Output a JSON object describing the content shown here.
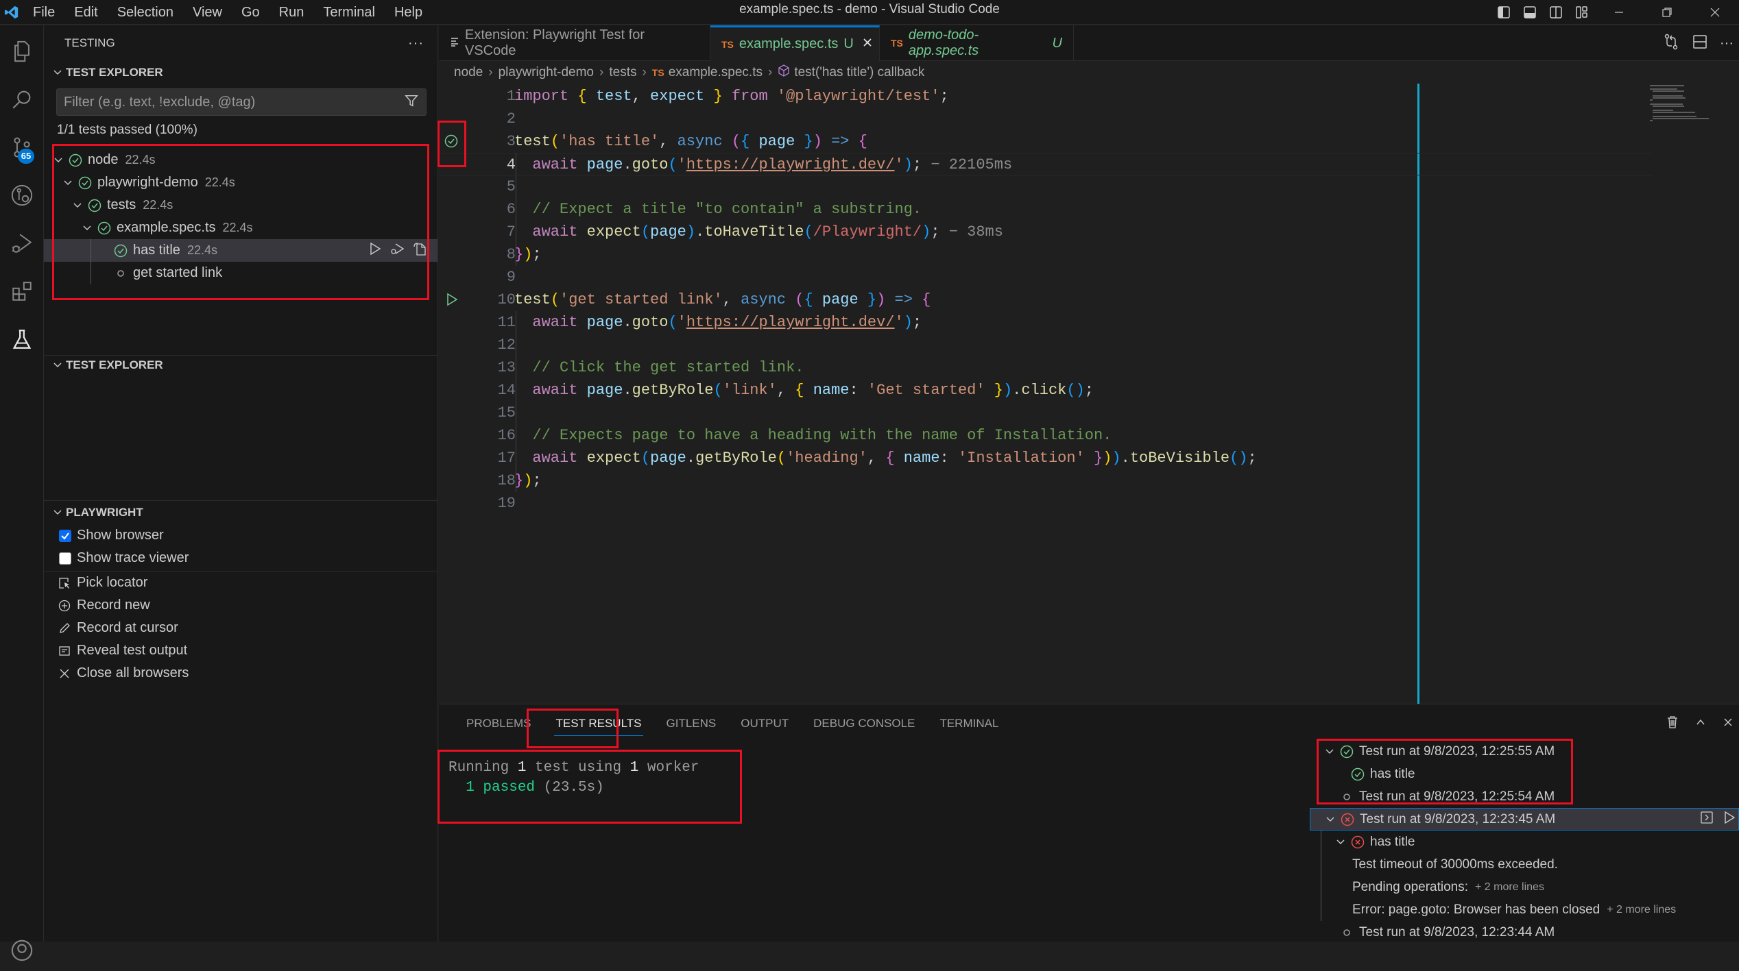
{
  "titlebar": {
    "title": "example.spec.ts - demo - Visual Studio Code",
    "menu": [
      "File",
      "Edit",
      "Selection",
      "View",
      "Go",
      "Run",
      "Terminal",
      "Help"
    ]
  },
  "activity_bar": {
    "items": [
      "explorer",
      "search",
      "source-control",
      "gitlens",
      "run-and-debug",
      "extensions",
      "testing"
    ],
    "source_control_badge": "65"
  },
  "sidebar": {
    "title": "TESTING",
    "test_explorer": {
      "header": "TEST EXPLORER",
      "filter_placeholder": "Filter (e.g. text, !exclude, @tag)",
      "summary": "1/1 tests passed (100%)",
      "tree": [
        {
          "label": "node",
          "duration": "22.4s",
          "status": "passed",
          "depth": 0,
          "expanded": true
        },
        {
          "label": "playwright-demo",
          "duration": "22.4s",
          "status": "passed",
          "depth": 1,
          "expanded": true
        },
        {
          "label": "tests",
          "duration": "22.4s",
          "status": "passed",
          "depth": 2,
          "expanded": true
        },
        {
          "label": "example.spec.ts",
          "duration": "22.4s",
          "status": "passed",
          "depth": 3,
          "expanded": true
        },
        {
          "label": "has title",
          "duration": "22.4s",
          "status": "passed",
          "depth": 4,
          "selected": true
        },
        {
          "label": "get started link",
          "duration": "",
          "status": "not-run",
          "depth": 4
        }
      ]
    },
    "test_explorer_2": {
      "header": "TEST EXPLORER"
    },
    "playwright": {
      "header": "PLAYWRIGHT",
      "settings": [
        {
          "label": "Show browser",
          "checked": true
        },
        {
          "label": "Show trace viewer",
          "checked": false
        }
      ],
      "actions": [
        {
          "label": "Pick locator",
          "icon": "pick-locator-icon"
        },
        {
          "label": "Record new",
          "icon": "add-circle-icon"
        },
        {
          "label": "Record at cursor",
          "icon": "pencil-icon"
        },
        {
          "label": "Reveal test output",
          "icon": "output-icon"
        },
        {
          "label": "Close all browsers",
          "icon": "close-icon"
        }
      ]
    }
  },
  "editor": {
    "tabs": [
      {
        "label": "Extension: Playwright Test for VSCode",
        "type": "preview",
        "active": false
      },
      {
        "label": "example.spec.ts",
        "badge": "U",
        "lang": "TS",
        "active": true
      },
      {
        "label": "demo-todo-app.spec.ts",
        "badge": "U",
        "lang": "TS",
        "active": false,
        "italic": true
      }
    ],
    "breadcrumb": [
      "node",
      "playwright-demo",
      "tests",
      "example.spec.ts",
      "test('has title') callback"
    ],
    "current_line": 4,
    "lines": [
      {
        "n": "1"
      },
      {
        "n": "2"
      },
      {
        "n": "3"
      },
      {
        "n": "4"
      },
      {
        "n": "5"
      },
      {
        "n": "6"
      },
      {
        "n": "7"
      },
      {
        "n": "8"
      },
      {
        "n": "9"
      },
      {
        "n": "10"
      },
      {
        "n": "11"
      },
      {
        "n": "12"
      },
      {
        "n": "13"
      },
      {
        "n": "14"
      },
      {
        "n": "15"
      },
      {
        "n": "16"
      },
      {
        "n": "17"
      },
      {
        "n": "18"
      },
      {
        "n": "19"
      }
    ],
    "code": {
      "l1": [
        "import",
        " { ",
        "test",
        ", ",
        "expect",
        " } ",
        "from",
        " ",
        "'@playwright/test'",
        ";"
      ],
      "l3": [
        "test",
        "(",
        "'has title'",
        ", ",
        "async",
        " (",
        "{",
        " ",
        "page",
        " ",
        "}",
        ")",
        " => ",
        "{"
      ],
      "l4": [
        "  ",
        "await",
        " ",
        "page",
        ".",
        "goto",
        "(",
        "'",
        "https://playwright.dev/",
        "'",
        ")",
        ";",
        " − 22105ms"
      ],
      "l6": [
        "  // Expect a title \"to contain\" a substring."
      ],
      "l7": [
        "  ",
        "await",
        " ",
        "expect",
        "(",
        "page",
        ")",
        ".",
        "toHaveTitle",
        "(",
        "/Playwright/",
        ")",
        ";",
        " − 38ms"
      ],
      "l8": [
        "}",
        ")",
        ";"
      ],
      "l10": [
        "test",
        "(",
        "'get started link'",
        ", ",
        "async",
        " (",
        "{",
        " ",
        "page",
        " ",
        "}",
        ")",
        " => ",
        "{"
      ],
      "l11": [
        "  ",
        "await",
        " ",
        "page",
        ".",
        "goto",
        "(",
        "'",
        "https://playwright.dev/",
        "'",
        ")",
        ";"
      ],
      "l13": [
        "  // Click the get started link."
      ],
      "l14": [
        "  ",
        "await",
        " ",
        "page",
        ".",
        "getByRole",
        "(",
        "'link'",
        ", ",
        "{",
        " ",
        "name",
        ": ",
        "'Get started'",
        " ",
        "}",
        ")",
        ".",
        "click",
        "(",
        ")",
        ";"
      ],
      "l16": [
        "  // Expects page to have a heading with the name of Installation."
      ],
      "l17": [
        "  ",
        "await",
        " ",
        "expect",
        "(",
        "page",
        ".",
        "getByRole",
        "(",
        "'heading'",
        ", ",
        "{",
        " ",
        "name",
        ": ",
        "'Installation'",
        " ",
        "}",
        ")",
        ")",
        ".",
        "toBeVisible",
        "(",
        ")",
        ";"
      ],
      "l18": [
        "}",
        ")",
        ";"
      ]
    },
    "gutter": {
      "line3": "passed",
      "line10": "run"
    }
  },
  "panel": {
    "tabs": [
      "PROBLEMS",
      "TEST RESULTS",
      "GITLENS",
      "OUTPUT",
      "DEBUG CONSOLE",
      "TERMINAL"
    ],
    "active_tab": "TEST RESULTS",
    "output": {
      "line1": {
        "a": "Running ",
        "b": "1",
        "c": " test using ",
        "d": "1",
        "e": " worker"
      },
      "line2": {
        "a": "  1 passed",
        "b": " (23.5s)"
      }
    },
    "results_tree": [
      {
        "label": "Test run at 9/8/2023, 12:25:55 AM",
        "status": "passed",
        "depth": 0,
        "expanded": true
      },
      {
        "label": "has title",
        "status": "passed",
        "depth": 1
      },
      {
        "label": "Test run at 9/8/2023, 12:25:54 AM",
        "status": "not-run",
        "depth": 0
      },
      {
        "label": "Test run at 9/8/2023, 12:23:45 AM",
        "status": "failed",
        "depth": 0,
        "expanded": true,
        "selected": true
      },
      {
        "label": "has title",
        "status": "failed",
        "depth": 1,
        "expanded": true
      },
      {
        "label": "Test timeout of 30000ms exceeded.",
        "status": "message",
        "depth": 2
      },
      {
        "label": "Pending operations:",
        "more": "+ 2 more lines",
        "status": "message",
        "depth": 2
      },
      {
        "label": "Error: page.goto: Browser has been closed",
        "more": "+ 2 more lines",
        "status": "message",
        "depth": 2
      },
      {
        "label": "Test run at 9/8/2023, 12:23:44 AM",
        "status": "not-run",
        "depth": 0
      }
    ]
  },
  "colors": {
    "accent": "#0078d4",
    "passed": "#73c991",
    "failed": "#f14c4c",
    "annotation": "#e81123",
    "ruler": "#15a8d1"
  }
}
